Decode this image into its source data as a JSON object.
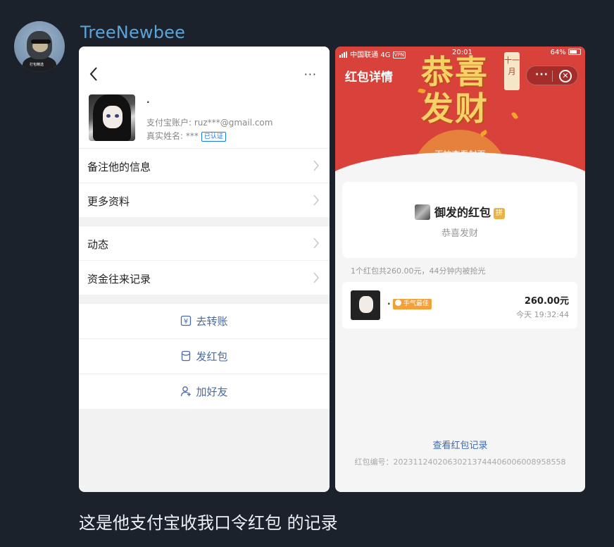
{
  "post": {
    "username": "TreeNewbee",
    "caption": "这是他支付宝收我口令红包 的记录"
  },
  "avatar": {
    "text_line1": "打包精选",
    "text_line2": ""
  },
  "left_screen": {
    "nickname": "·",
    "account": "支付宝账户: ruz***@gmail.com",
    "realname": "真实姓名: ***",
    "verified_badge": "已认证",
    "menu_group1": [
      "备注他的信息",
      "更多资料"
    ],
    "menu_group2": [
      "动态",
      "资金往来记录"
    ],
    "actions": [
      {
        "label": "去转账",
        "icon": "transfer-icon"
      },
      {
        "label": "发红包",
        "icon": "red-packet-icon"
      },
      {
        "label": "加好友",
        "icon": "add-friend-icon"
      }
    ],
    "more_glyph": "···"
  },
  "right_screen": {
    "status": {
      "carrier": "中国联通",
      "network": "4G",
      "vpn": "VPN",
      "time": "20:01",
      "battery": "64%"
    },
    "title": "红包详情",
    "cover_title": "恭喜发财",
    "month_tag": "十一月",
    "pull_hint": "下拉查看封面",
    "sender": "御发的红包",
    "pin_badge": "拼",
    "message": "恭喜发财",
    "summary": "1个红包共260.00元，44分钟内被抢光",
    "receiver": {
      "name": "·",
      "lucky_label": "手气最佳",
      "amount": "260.00元",
      "time": "今天 19:32:44"
    },
    "view_records": "查看红包记录",
    "packet_id": "红包编号：20231124020630213744406006008958558",
    "close_glyph": "✕",
    "dots_glyph": "···"
  },
  "colors": {
    "accent_red": "#d9423b",
    "link_blue": "#3d6bb0",
    "username_blue": "#5ba4d8",
    "gold": "#f6d266"
  }
}
